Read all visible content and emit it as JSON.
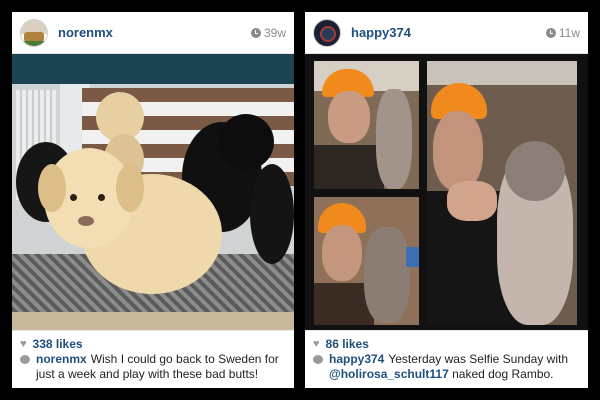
{
  "posts": [
    {
      "username": "norenmx",
      "time": "39w",
      "likes": "338 likes",
      "caption_user": "norenmx",
      "caption_text": "Wish I could go back to Sweden for just a week and play with these bad butts!",
      "avatar_colors": [
        "#c99a45",
        "#4c7a3a"
      ]
    },
    {
      "username": "happy374",
      "time": "11w",
      "likes": "86 likes",
      "caption_user": "happy374",
      "caption_text_before": "Yesterday was Selfie Sunday with",
      "mention": "@holirosa_schult117",
      "caption_text_after": "naked dog Rambo.",
      "avatar_colors": [
        "#2b3a55",
        "#a33d3d"
      ]
    }
  ],
  "colors": {
    "link": "#1f4f7c",
    "meta": "#8a8a8a",
    "background": "#000000",
    "hat": "#f08a1c"
  }
}
